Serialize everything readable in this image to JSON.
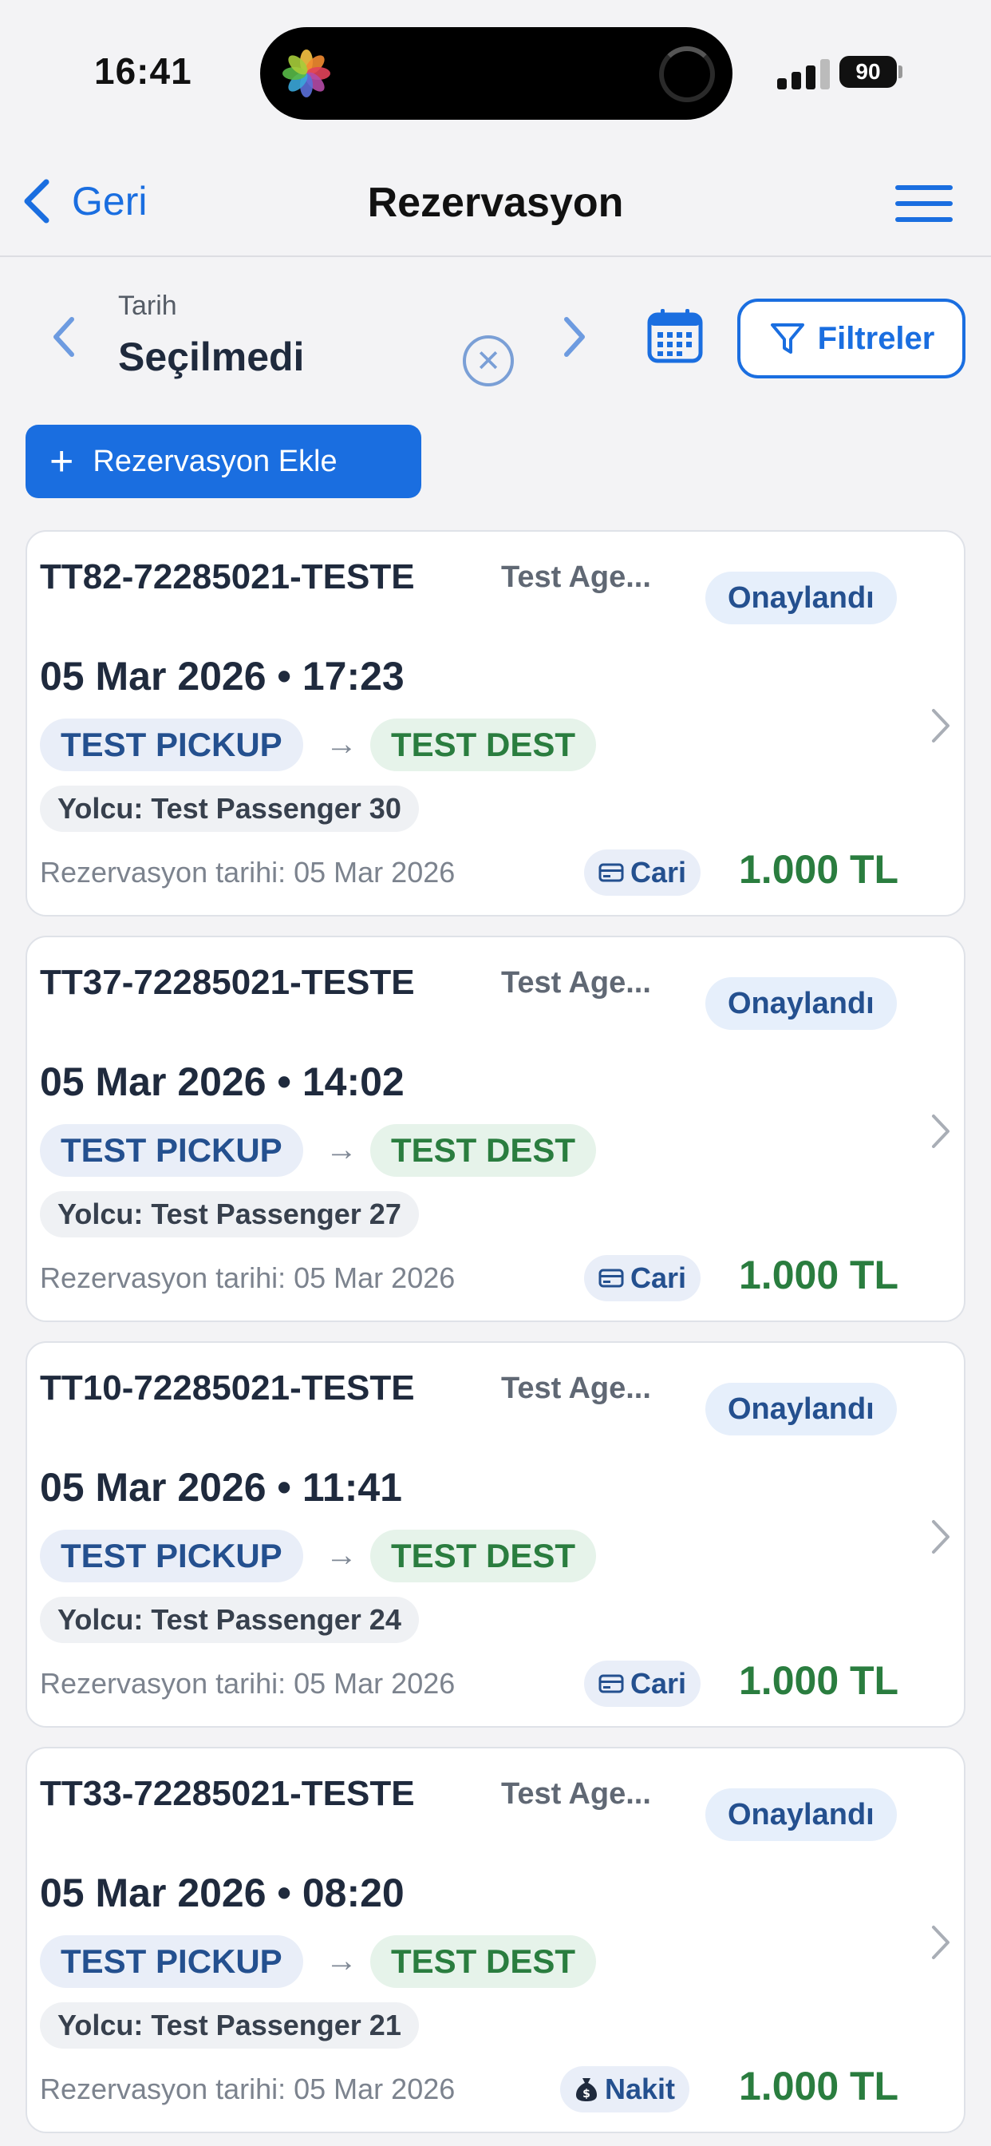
{
  "status_bar": {
    "time": "16:41",
    "battery": "90"
  },
  "nav": {
    "back_label": "Geri",
    "title": "Rezervasyon"
  },
  "filters": {
    "date_label": "Tarih",
    "date_value": "Seçilmedi",
    "filter_label": "Filtreler"
  },
  "add_button": {
    "label": "Rezervasyon Ekle"
  },
  "reservations": [
    {
      "code": "TT82-72285021-TESTE",
      "agency": "Test Age...",
      "status": "Onaylandı",
      "datetime": "05 Mar 2026 • 17:23",
      "pickup": "TEST PICKUP",
      "dest": "TEST DEST",
      "passenger": "Yolcu: Test Passenger 30",
      "res_date": "Rezervasyon tarihi: 05 Mar 2026",
      "payment": "Cari",
      "price": "1.000 TL"
    },
    {
      "code": "TT37-72285021-TESTE",
      "agency": "Test Age...",
      "status": "Onaylandı",
      "datetime": "05 Mar 2026 • 14:02",
      "pickup": "TEST PICKUP",
      "dest": "TEST DEST",
      "passenger": "Yolcu: Test Passenger 27",
      "res_date": "Rezervasyon tarihi: 05 Mar 2026",
      "payment": "Cari",
      "price": "1.000 TL"
    },
    {
      "code": "TT10-72285021-TESTE",
      "agency": "Test Age...",
      "status": "Onaylandı",
      "datetime": "05 Mar 2026 • 11:41",
      "pickup": "TEST PICKUP",
      "dest": "TEST DEST",
      "passenger": "Yolcu: Test Passenger 24",
      "res_date": "Rezervasyon tarihi: 05 Mar 2026",
      "payment": "Cari",
      "price": "1.000 TL"
    },
    {
      "code": "TT33-72285021-TESTE",
      "agency": "Test Age...",
      "status": "Onaylandı",
      "datetime": "05 Mar 2026 • 08:20",
      "pickup": "TEST PICKUP",
      "dest": "TEST DEST",
      "passenger": "Yolcu: Test Passenger 21",
      "res_date": "Rezervasyon tarihi: 05 Mar 2026",
      "payment": "Nakit",
      "price": "1.000 TL"
    }
  ],
  "colors": {
    "accent": "#1a6ee0",
    "price_green": "#2a7d3f",
    "status_blue": "#24508f"
  },
  "icons": [
    "back-chevron-icon",
    "menu-icon",
    "calendar-icon",
    "filter-icon",
    "clear-icon",
    "card-icon",
    "money-bag-icon",
    "chevron-right-icon"
  ]
}
